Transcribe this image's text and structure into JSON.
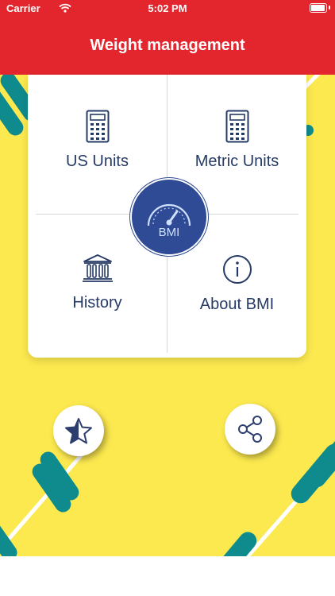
{
  "status": {
    "carrier": "Carrier",
    "time": "5:02 PM"
  },
  "header": {
    "title": "Weight management"
  },
  "tiles": {
    "us_units": "US Units",
    "metric_units": "Metric Units",
    "history": "History",
    "about": "About BMI"
  },
  "badge": {
    "label": "BMI"
  },
  "colors": {
    "header": "#e3262e",
    "background": "#fce94f",
    "accent": "#263a66",
    "badge": "#2f4b96",
    "dumbbell": "#0f8b8d"
  }
}
